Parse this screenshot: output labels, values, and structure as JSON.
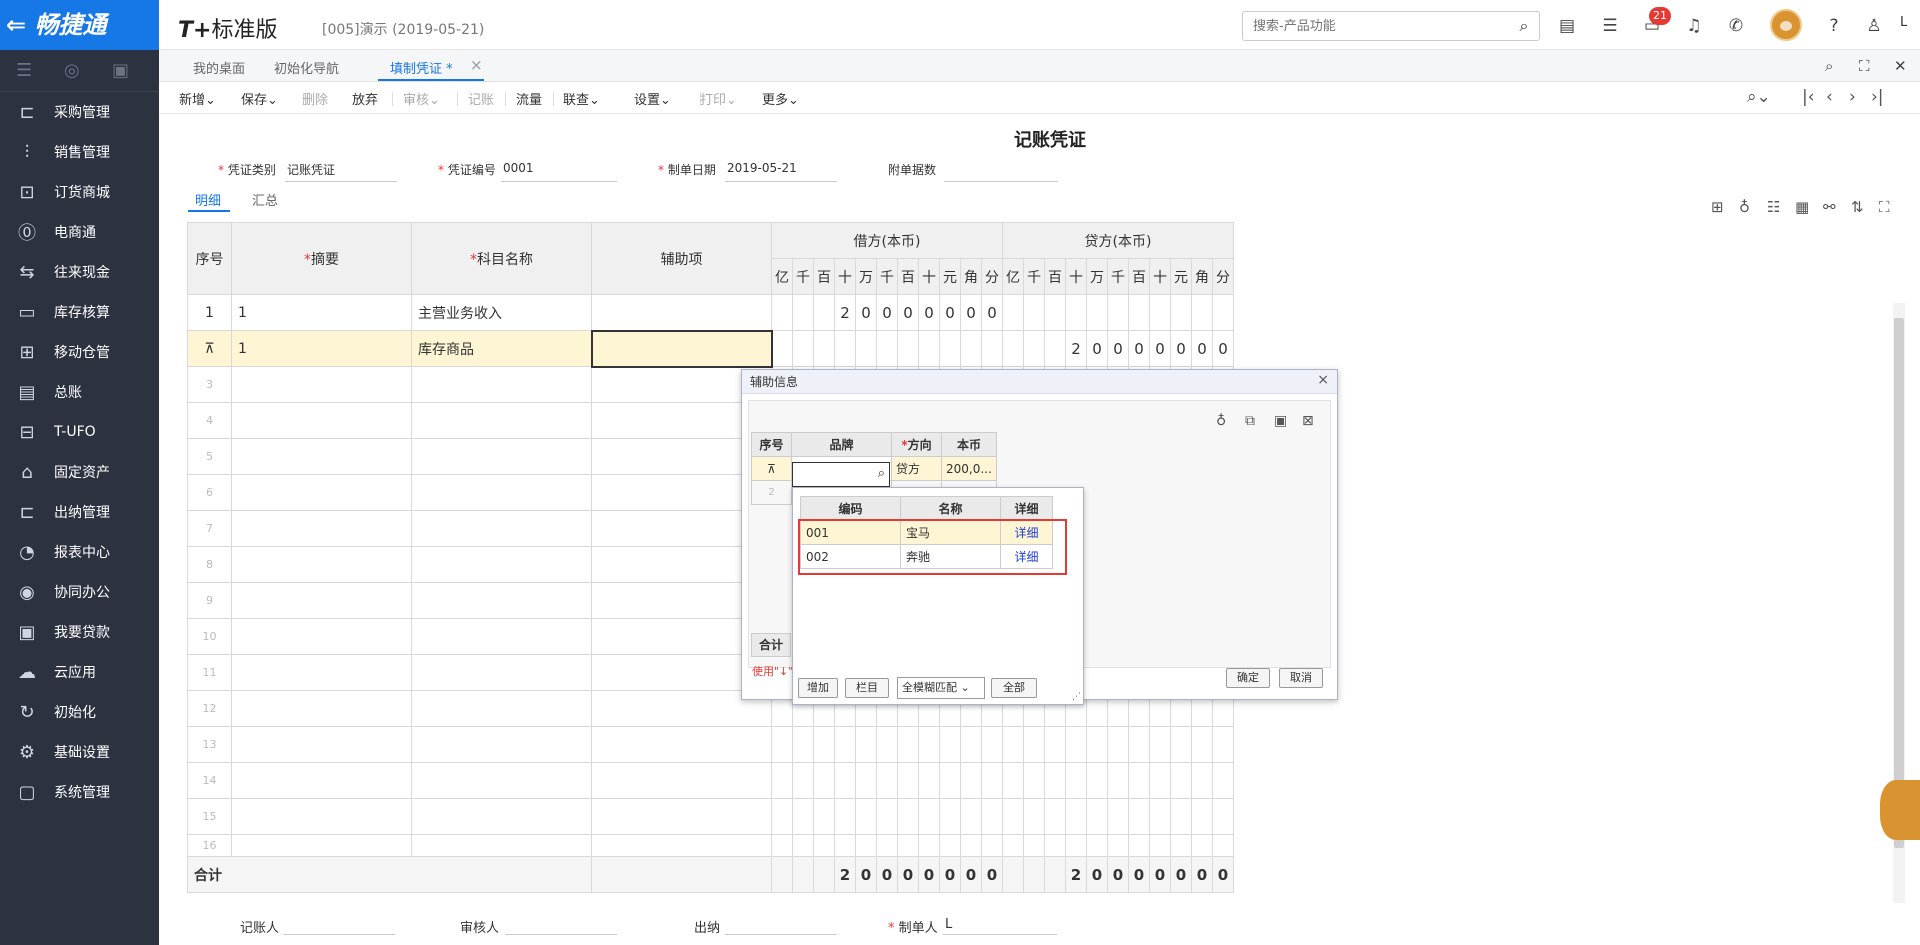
{
  "topbar": {
    "brand": "畅捷通",
    "product_prefix": "T+",
    "product_name": "标准版",
    "account": "[005]演示   (2019-05-21)",
    "search_placeholder": "搜索-产品功能",
    "notification_count": "21",
    "user": "L"
  },
  "sidebar": {
    "items": [
      {
        "label": "采购管理",
        "icon": "shopping-cart-icon"
      },
      {
        "label": "销售管理",
        "icon": "chart-bar-icon"
      },
      {
        "label": "订货商城",
        "icon": "store-icon"
      },
      {
        "label": "电商通",
        "icon": "ecommerce-icon"
      },
      {
        "label": "往来现金",
        "icon": "exchange-icon"
      },
      {
        "label": "库存核算",
        "icon": "warehouse-icon"
      },
      {
        "label": "移动仓管",
        "icon": "grid-icon"
      },
      {
        "label": "总账",
        "icon": "ledger-icon"
      },
      {
        "label": "T-UFO",
        "icon": "ufo-icon"
      },
      {
        "label": "固定资产",
        "icon": "bank-icon"
      },
      {
        "label": "出纳管理",
        "icon": "cashier-icon"
      },
      {
        "label": "报表中心",
        "icon": "report-icon"
      },
      {
        "label": "协同办公",
        "icon": "collaborate-icon"
      },
      {
        "label": "我要贷款",
        "icon": "loan-icon"
      },
      {
        "label": "云应用",
        "icon": "cloud-icon"
      },
      {
        "label": "初始化",
        "icon": "init-icon"
      },
      {
        "label": "基础设置",
        "icon": "settings-icon"
      },
      {
        "label": "系统管理",
        "icon": "system-icon"
      }
    ]
  },
  "tabs": {
    "desktop": "我的桌面",
    "init_nav": "初始化导航",
    "voucher": "填制凭证 *"
  },
  "toolbar": {
    "new": "新增",
    "save": "保存",
    "delete": "删除",
    "discard": "放弃",
    "review": "审核",
    "post": "记账",
    "flow": "流量",
    "link": "联查",
    "settings": "设置",
    "print": "打印",
    "more": "更多"
  },
  "voucher": {
    "title": "记账凭证",
    "type_label": "凭证类别",
    "type_value": "记账凭证",
    "no_label": "凭证编号",
    "no_value": "0001",
    "date_label": "制单日期",
    "date_value": "2019-05-21",
    "attach_label": "附单据数",
    "subtab_detail": "明细",
    "subtab_summary": "汇总"
  },
  "grid": {
    "h_seq": "序号",
    "h_summary": "摘要",
    "h_account": "科目名称",
    "h_aux": "辅助项",
    "h_debit": "借方(本币)",
    "h_credit": "贷方(本币)",
    "digits": [
      "亿",
      "千",
      "百",
      "十",
      "万",
      "千",
      "百",
      "十",
      "元",
      "角",
      "分"
    ],
    "rows": [
      {
        "seq": "1",
        "summary": "1",
        "account": "主营业务收入",
        "debit": [
          "",
          "",
          "",
          "2",
          "0",
          "0",
          "0",
          "0",
          "0",
          "0",
          "0"
        ],
        "credit": [
          "",
          "",
          "",
          "",
          "",
          "",
          "",
          "",
          "",
          "",
          ""
        ]
      },
      {
        "seq": "",
        "summary": "1",
        "account": "库存商品",
        "debit": [
          "",
          "",
          "",
          "",
          "",
          "",
          "",
          "",
          "",
          "",
          ""
        ],
        "credit": [
          "",
          "",
          "",
          "2",
          "0",
          "0",
          "0",
          "0",
          "0",
          "0",
          "0"
        ]
      }
    ],
    "empty_rows": [
      "3",
      "4",
      "5",
      "6",
      "7",
      "8",
      "9",
      "10",
      "11",
      "12",
      "13",
      "14",
      "15",
      "16"
    ],
    "total_label": "合计",
    "total_debit": [
      "",
      "",
      "",
      "2",
      "0",
      "0",
      "0",
      "0",
      "0",
      "0",
      "0"
    ],
    "total_credit": [
      "",
      "",
      "",
      "2",
      "0",
      "0",
      "0",
      "0",
      "0",
      "0",
      "0"
    ]
  },
  "footer": {
    "bookkeeper": "记账人",
    "reviewer": "审核人",
    "cashier": "出纳",
    "preparer": "制单人",
    "preparer_value": "L"
  },
  "aux_dialog": {
    "title": "辅助信息",
    "h_seq": "序号",
    "h_brand": "品牌",
    "h_direction": "方向",
    "h_amount": "本币",
    "row_direction": "贷方",
    "row_amount": "200,0...",
    "row2_seq": "2",
    "sum_label": "合计",
    "hint": "使用\"↓\"",
    "ok": "确定",
    "cancel": "取消"
  },
  "brand_dropdown": {
    "h_code": "编码",
    "h_name": "名称",
    "h_detail": "详细",
    "items": [
      {
        "code": "001",
        "name": "宝马",
        "detail": "详细"
      },
      {
        "code": "002",
        "name": "奔驰",
        "detail": "详细"
      }
    ],
    "add": "增加",
    "columns": "栏目",
    "match_mode": "全模糊匹配",
    "all": "全部"
  }
}
